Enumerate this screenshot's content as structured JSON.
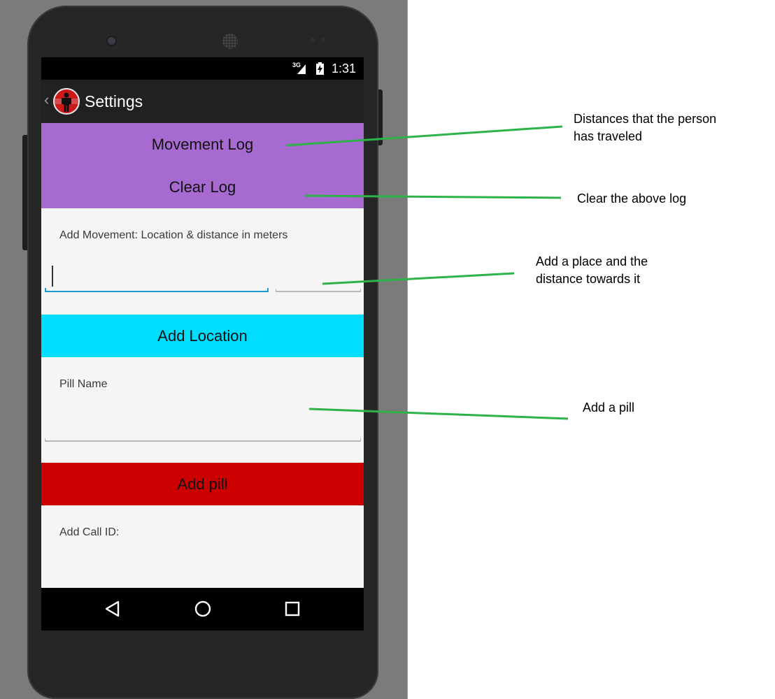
{
  "status_bar": {
    "network": "3G",
    "time": "1:31"
  },
  "action_bar": {
    "title": "Settings"
  },
  "buttons": {
    "movement_log": "Movement Log",
    "clear_log": "Clear Log",
    "add_location": "Add Location",
    "add_pill": "Add pill"
  },
  "fields": {
    "movement_label": "Add Movement: Location & distance in meters",
    "location_value": "",
    "distance_value": "",
    "pill_label": "Pill Name",
    "pill_value": "",
    "call_label": "Add Call ID:"
  },
  "annotations": {
    "movement_log_line1": "Distances that the person",
    "movement_log_line2": "has traveled",
    "clear_log": "Clear the above log",
    "add_location_line1": "Add a place and the",
    "add_location_line2": "distance towards it",
    "add_pill": "Add a pill"
  },
  "colors": {
    "movement_log_bg": "#a76ad0",
    "add_location_bg": "#00ddff",
    "add_pill_bg": "#cc0000",
    "callout_line": "#2db34a",
    "focus_underline": "#1e9ad6"
  },
  "icons": [
    "signal-icon",
    "battery-icon",
    "back-icon",
    "app-logo",
    "nav-back-icon",
    "nav-home-icon",
    "nav-recents-icon"
  ]
}
